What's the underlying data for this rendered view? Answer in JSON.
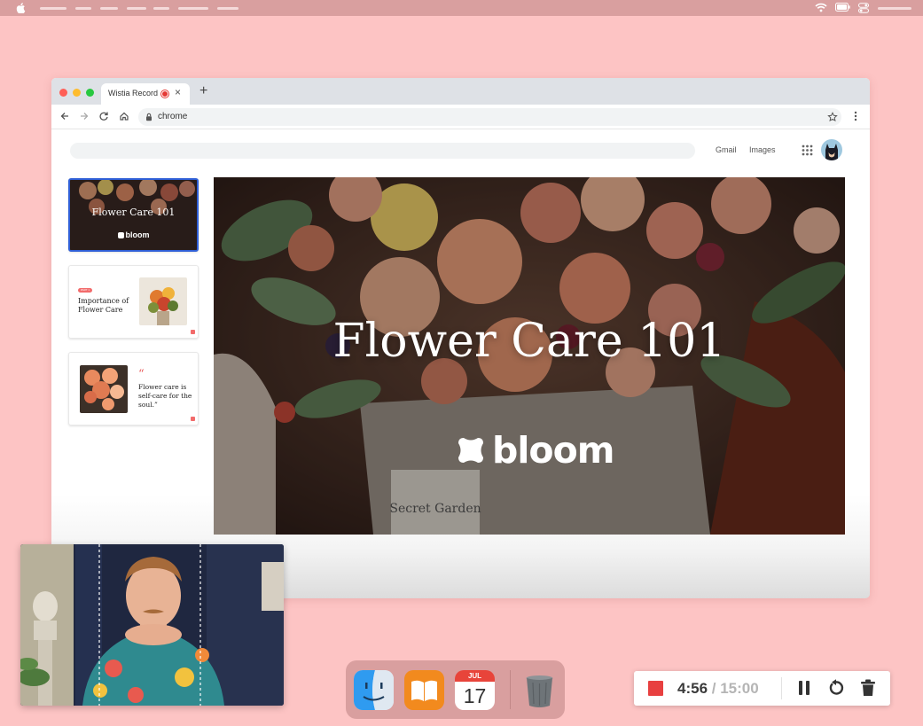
{
  "browser": {
    "tab_title": "Wistia Record",
    "tab_close": "×",
    "new_tab": "+",
    "address": "chrome"
  },
  "google_header": {
    "links": [
      "Gmail",
      "Images"
    ]
  },
  "slides": [
    {
      "title": "Flower Care 101",
      "brand": "bloom",
      "active": true
    },
    {
      "badge": "PART 1",
      "title": "Importance of Flower Care",
      "active": false
    },
    {
      "quote_mark": "“",
      "quote": "Flower care is self-care for the soul.”",
      "active": false
    }
  ],
  "main_slide": {
    "title": "Flower Care 101",
    "brand": "bloom",
    "box_label": "Secret Garden"
  },
  "dock": {
    "calendar_month": "JUL",
    "calendar_day": "17"
  },
  "recorder": {
    "elapsed": "4:56",
    "separator": " / ",
    "limit": "15:00"
  },
  "colors": {
    "desktop": "#fdc4c4",
    "menubar": "#d99f9f",
    "record_red": "#e84040",
    "active_slide_border": "#2f5fd6"
  },
  "icons": [
    "apple-icon",
    "wifi-icon",
    "battery-icon",
    "control-center-icon",
    "back-icon",
    "forward-icon",
    "reload-icon",
    "home-icon",
    "lock-icon",
    "star-icon",
    "kebab-menu-icon",
    "apps-grid-icon",
    "finder-icon",
    "books-icon",
    "calendar-icon",
    "trash-icon",
    "pause-icon",
    "restart-icon",
    "delete-icon"
  ]
}
